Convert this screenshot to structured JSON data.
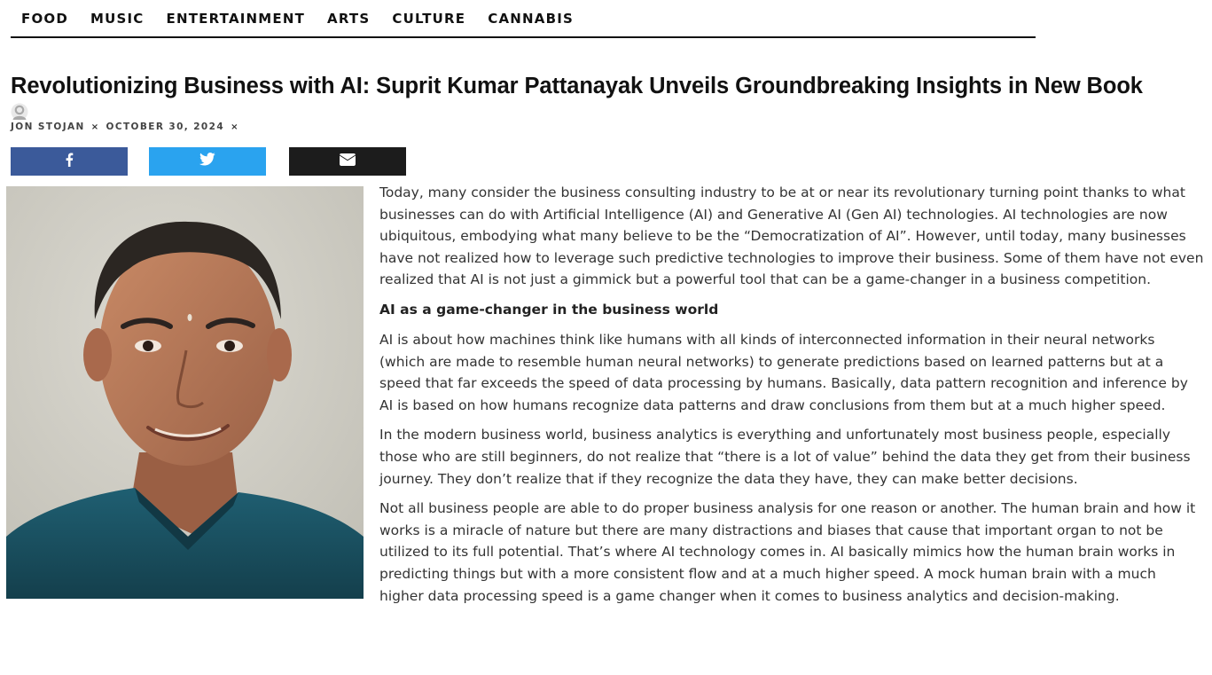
{
  "nav": {
    "items": [
      {
        "label": "FOOD"
      },
      {
        "label": "MUSIC"
      },
      {
        "label": "ENTERTAINMENT"
      },
      {
        "label": "ARTS"
      },
      {
        "label": "CULTURE"
      },
      {
        "label": "CANNABIS"
      }
    ]
  },
  "article": {
    "title": "Revolutionizing Business with AI: Suprit Kumar Pattanayak Unveils Groundbreaking Insights in New Book",
    "author": "JON STOJAN",
    "separator": "×",
    "date": "OCTOBER 30, 2024",
    "share": {
      "facebook_icon": "facebook-icon",
      "twitter_icon": "twitter-icon",
      "email_icon": "envelope-icon",
      "facebook_color": "#3b5a9a",
      "twitter_color": "#2aa3ef",
      "email_color": "#1c1c1c"
    },
    "paragraphs": [
      "Today, many consider the business consulting industry to be at or near its revolutionary turning point thanks to what businesses can do with Artificial Intelligence (AI) and Generative AI (Gen AI) technologies. AI technologies are now ubiquitous, embodying what many believe to be the “Democratization of AI”. However, until today, many businesses have not realized how to leverage such predictive technologies to improve their business. Some of them have not even realized that AI is not just a gimmick but a powerful tool that can be a game-changer in a business competition.",
      "AI as a game-changer in the business world",
      "AI is about how machines think like humans with all kinds of interconnected information in their neural networks (which are made to resemble human neural networks) to generate predictions based on learned patterns but at a speed that far exceeds the speed of data processing by humans. Basically, data pattern recognition and inference by AI is based on how humans recognize data patterns and draw conclusions from them but at a much higher speed.",
      "In the modern business world, business analytics is everything and unfortunately most business people, especially those who are still beginners, do not realize that “there is a lot of value” behind the data they get from their business journey. They don’t realize that if they recognize the data they have, they can make better decisions.",
      "Not all business people are able to do proper business analysis for one reason or another. The human brain and how it works is a miracle of nature but there are many distractions and biases that cause that important organ to not be utilized to its full potential. That’s where AI technology comes in. AI basically mimics how the human brain works in predicting things but with a more consistent flow and at a much higher speed. A mock human brain with a much higher data processing speed is a game changer when it comes to business analytics and decision-making."
    ]
  }
}
